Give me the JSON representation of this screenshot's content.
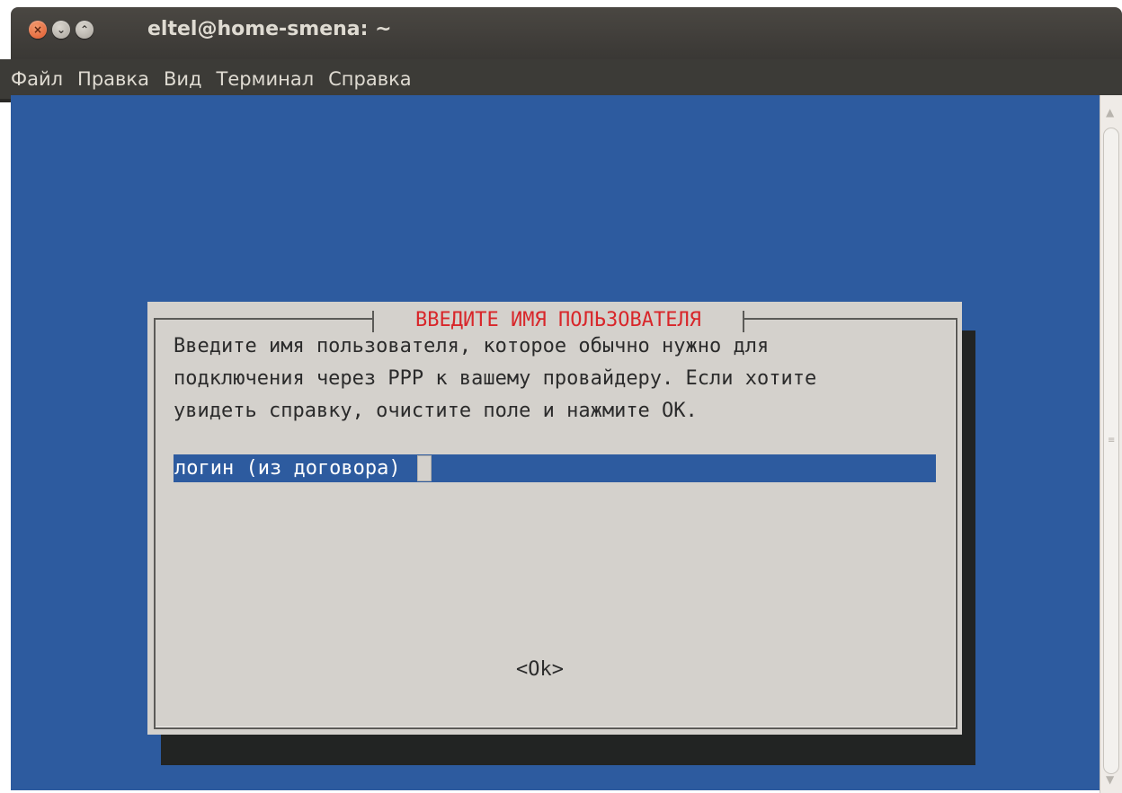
{
  "window": {
    "title": "eltel@home-smena: ~",
    "controls": {
      "close": "×",
      "minimize": "⌄",
      "maximize": "⌃"
    }
  },
  "menubar": {
    "items": [
      {
        "label": "Файл"
      },
      {
        "label": "Правка"
      },
      {
        "label": "Вид"
      },
      {
        "label": "Терминал"
      },
      {
        "label": "Справка"
      }
    ]
  },
  "dialog": {
    "title": "ВВЕДИТЕ ИМЯ ПОЛЬЗОВАТЕЛЯ",
    "text_lines": [
      "Введите имя пользователя, которое обычно нужно для",
      "подключения через PPP к вашему провайдеру. Если хотите",
      "увидеть справку, очистите поле и нажмите OK."
    ],
    "input": {
      "value": "логин (из договора)"
    },
    "ok_label": "<Ok>"
  },
  "colors": {
    "terminal_bg": "#2d5b9f",
    "dialog_bg": "#d4d1cc",
    "title_red": "#d8262a",
    "shadow": "#222423"
  }
}
